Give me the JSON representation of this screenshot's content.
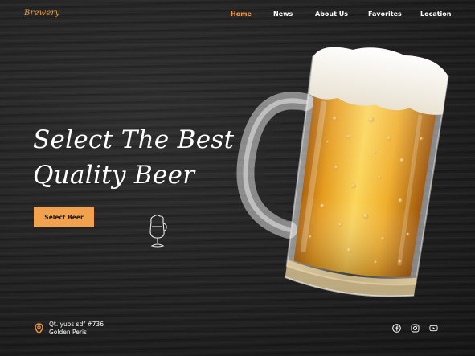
{
  "brand": {
    "logo_text": "Brewery",
    "accent_color": "#f29a3f"
  },
  "nav": {
    "items": [
      {
        "label": "Home",
        "active": true
      },
      {
        "label": "News",
        "active": false
      },
      {
        "label": "About Us",
        "active": false
      },
      {
        "label": "Favorites",
        "active": false
      },
      {
        "label": "Location",
        "active": false
      }
    ]
  },
  "hero": {
    "headline_line1": "Select The Best",
    "headline_line2": "Quality Beer",
    "cta_label": "Select Beer",
    "cta_color": "#f2a24e",
    "image": "beer-mug"
  },
  "footer": {
    "address_icon": "location-pin-icon",
    "address_line1": "Qt. yuos sdf #736",
    "address_line2": "Golden Peris",
    "social": [
      "facebook-icon",
      "instagram-icon",
      "youtube-icon"
    ]
  }
}
